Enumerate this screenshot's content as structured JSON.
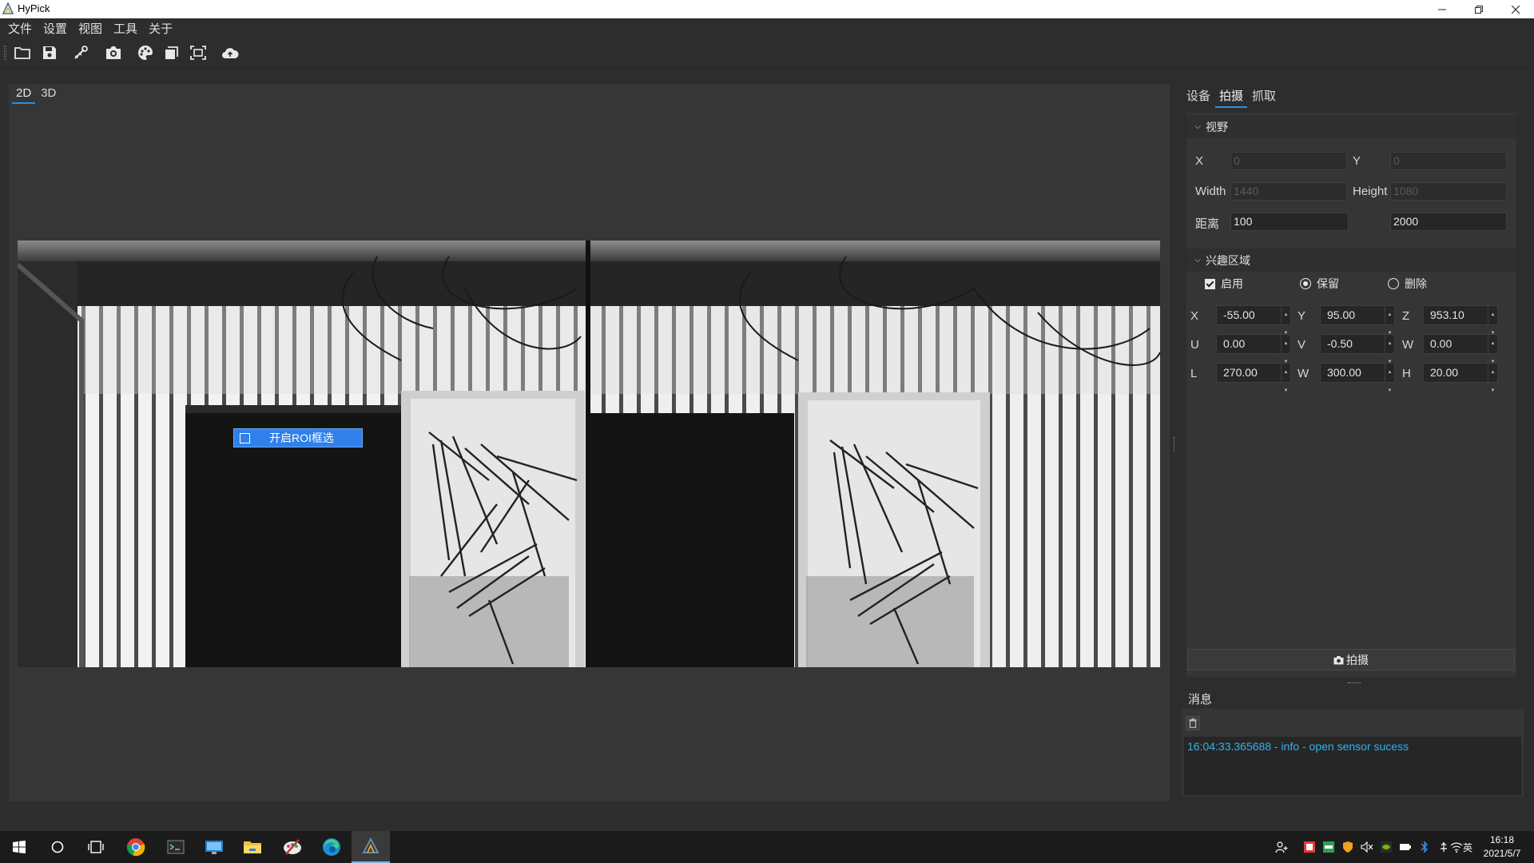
{
  "window": {
    "title": "HyPick"
  },
  "menu": [
    "文件",
    "设置",
    "视图",
    "工具",
    "关于"
  ],
  "toolbar": [
    "open-folder-icon",
    "save-icon",
    "calibrate-icon",
    "camera-icon",
    "palette-icon",
    "layers-icon",
    "fit-view-icon",
    "cloud-upload-icon"
  ],
  "viewer": {
    "tabs": [
      {
        "label": "2D",
        "active": true
      },
      {
        "label": "3D",
        "active": false
      }
    ],
    "roi_toggle": {
      "label": "开启ROI框选",
      "checked": false
    }
  },
  "right_tabs": [
    {
      "label": "设备",
      "active": false
    },
    {
      "label": "拍摄",
      "active": true
    },
    {
      "label": "抓取",
      "active": false
    }
  ],
  "fov": {
    "header": "视野",
    "x_label": "X",
    "x": "0",
    "y_label": "Y",
    "y": "0",
    "width_label": "Width",
    "width": "1440",
    "height_label": "Height",
    "height": "1080",
    "distance_label": "距离",
    "distance_min": "100",
    "distance_max": "2000"
  },
  "roi": {
    "header": "兴趣区域",
    "enable_label": "启用",
    "enabled": true,
    "keep_label": "保留",
    "delete_label": "删除",
    "mode": "keep",
    "params": [
      {
        "label": "X",
        "value": "-55.00"
      },
      {
        "label": "Y",
        "value": "95.00"
      },
      {
        "label": "Z",
        "value": "953.10"
      },
      {
        "label": "U",
        "value": "0.00"
      },
      {
        "label": "V",
        "value": "-0.50"
      },
      {
        "label": "W",
        "value": "0.00"
      },
      {
        "label": "L",
        "value": "270.00"
      },
      {
        "label": "W",
        "value": "300.00"
      },
      {
        "label": "H",
        "value": "20.00"
      }
    ]
  },
  "capture_button": {
    "label": "拍摄",
    "icon": "camera-icon"
  },
  "messages": {
    "tab": "消息",
    "entries": [
      "16:04:33.365688 - info - open sensor sucess"
    ]
  },
  "taskbar": {
    "apps": [
      "start-icon",
      "search-icon",
      "task-view-icon",
      "chrome-icon",
      "terminal-icon",
      "remote-desktop-icon",
      "file-explorer-icon",
      "paint-icon",
      "edge-icon",
      "hypick-icon"
    ],
    "ime": "英",
    "time": "16:18",
    "date": "2021/5/7"
  },
  "colors": {
    "accent": "#2d8ee0",
    "log_text": "#2fb2ee",
    "roi_overlay": "#2f80ea"
  }
}
